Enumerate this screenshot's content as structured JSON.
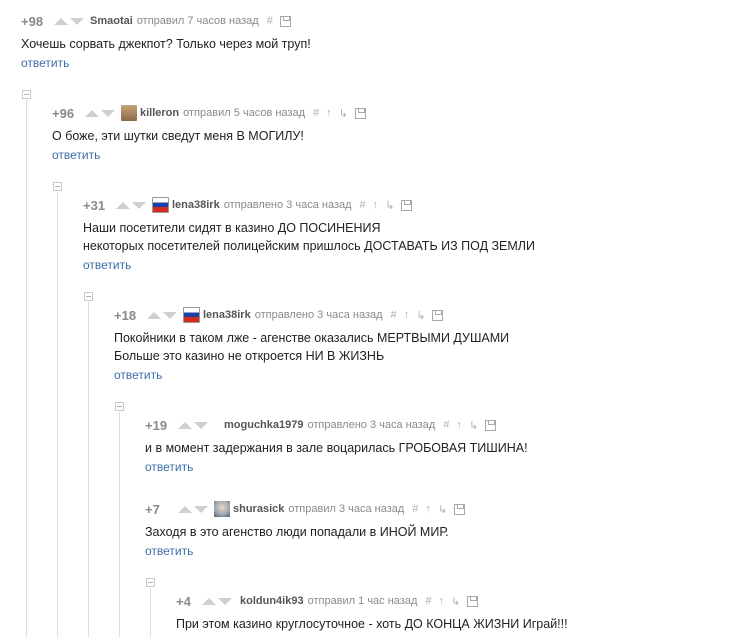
{
  "comments": [
    {
      "score": "+98",
      "user": "Smaotai",
      "meta": "отправил 7 часов назад",
      "text": [
        "Хочешь сорвать джекпот? Только через мой труп!"
      ],
      "reply": "ответить"
    },
    {
      "score": "+96",
      "user": "killeron",
      "meta": "отправил 5 часов назад",
      "text": [
        "О боже,  эти шутки сведут меня В МОГИЛУ!"
      ],
      "reply": "ответить"
    },
    {
      "score": "+31",
      "user": "lena38irk",
      "meta": "отправлено 3 часа назад",
      "text": [
        "Наши посетители сидят в казино ДО ПОСИНЕНИЯ",
        "некоторых посетителей полицейским пришлось ДОСТАВАТЬ ИЗ ПОД ЗЕМЛИ"
      ],
      "reply": "ответить"
    },
    {
      "score": "+18",
      "user": "lena38irk",
      "meta": "отправлено 3 часа назад",
      "text": [
        "Покойники в таком лже - агенстве оказались МЕРТВЫМИ ДУШАМИ",
        "Больше это казино не откроется НИ В ЖИЗНЬ"
      ],
      "reply": "ответить"
    },
    {
      "score": "+19",
      "user": "moguchka1979",
      "meta": "отправлено 3 часа назад",
      "text": [
        "и в момент задержания в зале воцарилась ГРОБОВАЯ ТИШИНА!"
      ],
      "reply": "ответить"
    },
    {
      "score": "+7",
      "user": "shurasick",
      "meta": "отправил 3 часа назад",
      "text": [
        "Заходя в это агенство люди попадали в ИНОЙ МИР."
      ],
      "reply": "ответить"
    },
    {
      "score": "+4",
      "user": "koldun4ik93",
      "meta": "отправил 1 час назад",
      "text": [
        "При этом казино круглосуточное - хоть ДО КОНЦА ЖИЗНИ Играй!!!"
      ],
      "reply": ""
    }
  ],
  "tools": {
    "link": "#",
    "parent": "↑",
    "branch": "↳"
  },
  "icons": [
    "vote-up-icon",
    "vote-down-icon",
    "link-icon",
    "parent-icon",
    "branch-icon",
    "save-icon",
    "collapse-icon"
  ]
}
